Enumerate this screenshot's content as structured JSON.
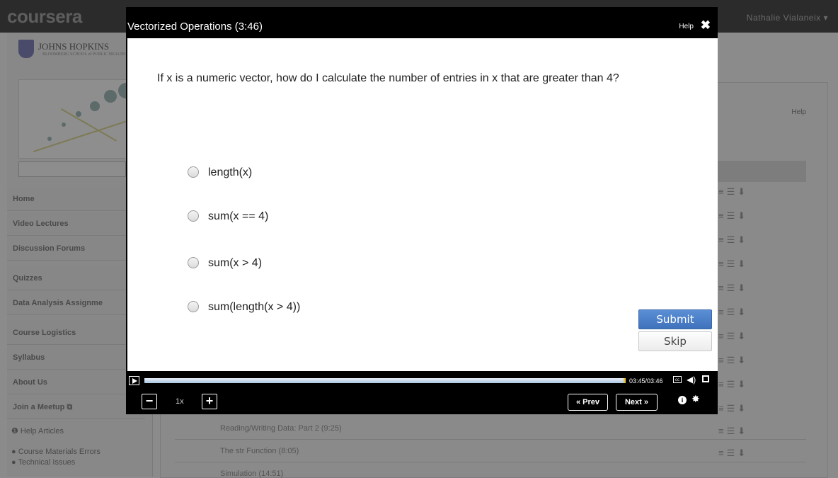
{
  "header": {
    "logo": "coursera",
    "user_name": "Nathalie Vialaneix ▾"
  },
  "sidebar": {
    "university_name": "JOHNS HOPKINS",
    "university_sub": "BLOOMBERG SCHOOL of PUBLIC HEALTH",
    "nav": [
      {
        "label": "Home"
      },
      {
        "label": "Video Lectures"
      },
      {
        "label": "Discussion Forums"
      },
      {
        "label": "Quizzes"
      },
      {
        "label": "Data Analysis Assignme"
      },
      {
        "label": "Course Logistics"
      },
      {
        "label": "Syllabus"
      },
      {
        "label": "About Us"
      },
      {
        "label": "Join a Meetup ⧉"
      }
    ],
    "help_links": [
      {
        "label": "❶ Help Articles"
      },
      {
        "label": "● Course Materials Errors"
      },
      {
        "label": "● Technical Issues"
      }
    ]
  },
  "content": {
    "help_label": "Help",
    "lectures": [
      {
        "title": "Reading/Writing Data: Part 2 (9:25)"
      },
      {
        "title": "The str Function (8:05)"
      },
      {
        "title": "Simulation (14:51)"
      }
    ]
  },
  "modal": {
    "title": "Vectorized Operations (3:46)",
    "help_label": "Help",
    "close_glyph": "✖",
    "question": "If x is a numeric vector, how do I calculate the number of entries in x that are greater than 4?",
    "options": [
      {
        "label": "length(x)"
      },
      {
        "label": "sum(x == 4)"
      },
      {
        "label": "sum(x > 4)"
      },
      {
        "label": "sum(length(x > 4))"
      }
    ],
    "submit_label": "Submit",
    "skip_label": "Skip"
  },
  "player": {
    "progress_fraction": 0.9956,
    "time": "03:45/03:46",
    "cc_label": "cc",
    "volume_glyph": "◀)",
    "speed": "1x",
    "minus_glyph": "−",
    "plus_glyph": "+",
    "prev_label": "« Prev",
    "next_label": "Next »",
    "info_glyph": "i",
    "gear_glyph": "✸"
  }
}
